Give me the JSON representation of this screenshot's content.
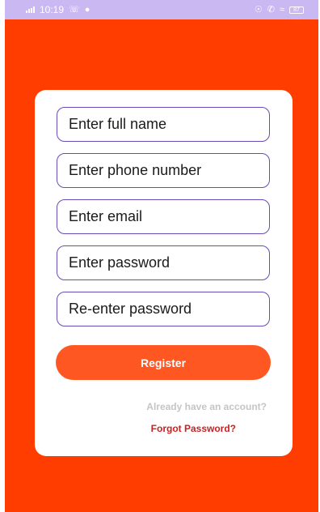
{
  "status_bar": {
    "time": "10:19",
    "left_icons": [
      "notification-icon",
      "notification-icon"
    ],
    "right_icons": [
      "location-icon",
      "call-icon",
      "wifi-icon",
      "battery-icon"
    ],
    "battery_level": "87",
    "background_color": "#c9b8f2"
  },
  "theme": {
    "background_color": "#ff3d00",
    "card_color": "#ffffff",
    "field_border_color": "#6a4bb8",
    "button_color": "#ff5722",
    "link_muted_color": "#c5c5c5",
    "link_accent_color": "#cc1f1f"
  },
  "form": {
    "full_name_placeholder": "Enter full name",
    "phone_placeholder": "Enter phone number",
    "email_placeholder": "Enter email",
    "password_placeholder": "Enter password",
    "confirm_password_placeholder": "Re-enter password",
    "register_label": "Register",
    "login_link_text": "Already have an account?",
    "forgot_password_text": "Forgot Password?"
  }
}
